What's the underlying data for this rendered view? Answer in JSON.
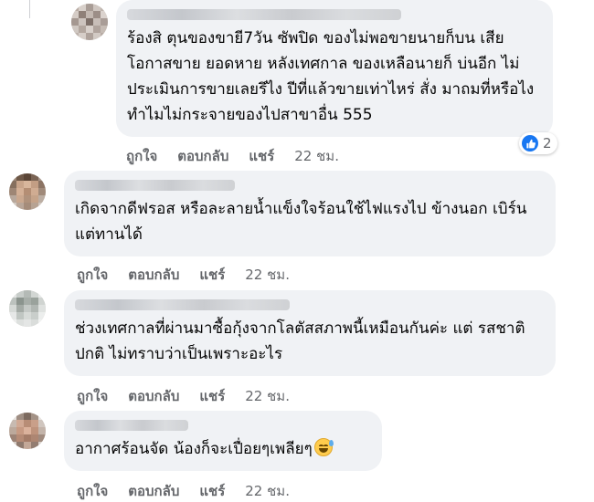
{
  "comments": [
    {
      "text": "ร้องสิ ตุนของขายี7วัน ซัพปิด ของไม่พอขายนายก็บน เสียโอกาสขาย ยอดหาย หลังเทศกาล ของเหลือนายก็ บ่นอีก ไม่ประเมินการขายเลยรึไง ปีที่แล้วขายเท่าไหร่ สั่ง มาถมที่หรือไง ทำไมไม่กระจายของไปสาขาอื่น 555",
      "actions": {
        "like": "ถูกใจ",
        "reply": "ตอบกลับ",
        "share": "แชร์",
        "time": "22 ชม."
      },
      "reactions": {
        "icon": "like-icon",
        "count": "2",
        "color": "#1877f2"
      }
    },
    {
      "text": "เกิดจากดีฟรอส หรือละลายน้ำแข็งใจร้อนใช้ไฟแรงไป ข้างนอก เบิร์น แต่ทานได้",
      "actions": {
        "like": "ถูกใจ",
        "reply": "ตอบกลับ",
        "share": "แชร์",
        "time": "22 ชม."
      }
    },
    {
      "text": "ช่วงเทศกาลที่ผ่านมาซื้อกุ้งจากโลตัสสภาพนี้เหมือนกันค่ะ แต่ รสชาติปกติ ไม่ทราบว่าเป็นเพราะอะไร",
      "actions": {
        "like": "ถูกใจ",
        "reply": "ตอบกลับ",
        "share": "แชร์",
        "time": "22 ชม."
      }
    },
    {
      "text": "อากาศร้อนจัด น้องก็จะเปื่อยๆเพลียๆ",
      "emoji": "grinning-sweat-emoji",
      "actions": {
        "like": "ถูกใจ",
        "reply": "ตอบกลับ",
        "share": "แชร์",
        "time": "22 ชม."
      }
    }
  ],
  "colors": {
    "bubble": "#f0f2f5",
    "meta_text": "#65676b",
    "text": "#050505",
    "like_blue": "#1877f2"
  }
}
